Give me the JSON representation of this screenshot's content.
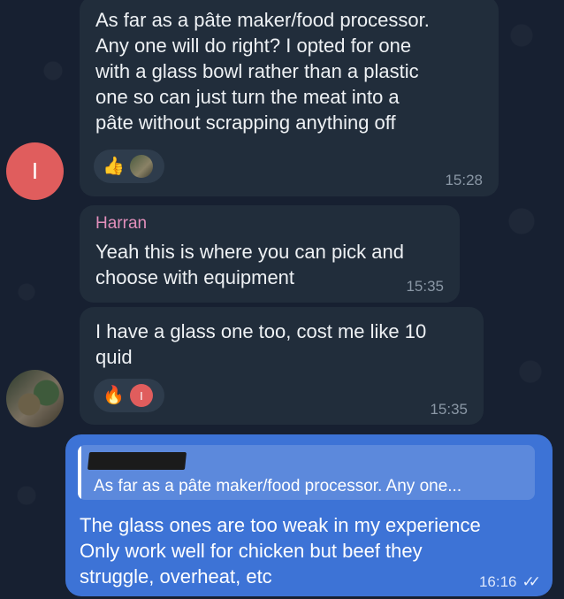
{
  "messages": [
    {
      "avatar_initial": "I",
      "text_lines": [
        "As far as a pâte maker/food processor.",
        "Any one will do right? I opted for one",
        "with a glass bowl rather than a plastic",
        "one so can just turn the meat into a",
        "pâte without scrapping anything off"
      ],
      "reaction_emoji": "👍",
      "time": "15:28"
    },
    {
      "sender": "Harran",
      "text_lines": [
        "Yeah this is where you can pick and",
        "choose with equipment"
      ],
      "time": "15:35"
    },
    {
      "text_lines": [
        "I have a glass one too, cost me like 10",
        "quid"
      ],
      "reaction_emoji": "🔥",
      "reaction_avatar_initial": "I",
      "time": "15:35"
    }
  ],
  "outgoing": {
    "reply_preview": "As far as a pâte maker/food processor. Any one...",
    "text_lines": [
      "The glass ones are too weak in my experience",
      "Only work well for chicken but beef they",
      "struggle, overheat, etc"
    ],
    "time": "16:16",
    "status_icon": "double-check-icon"
  },
  "colors": {
    "background": "#172031",
    "incoming_bubble": "#212d3b",
    "outgoing_bubble": "#3d73d6",
    "sender_name": "#e28fbb",
    "avatar_red": "#e05d5d"
  }
}
